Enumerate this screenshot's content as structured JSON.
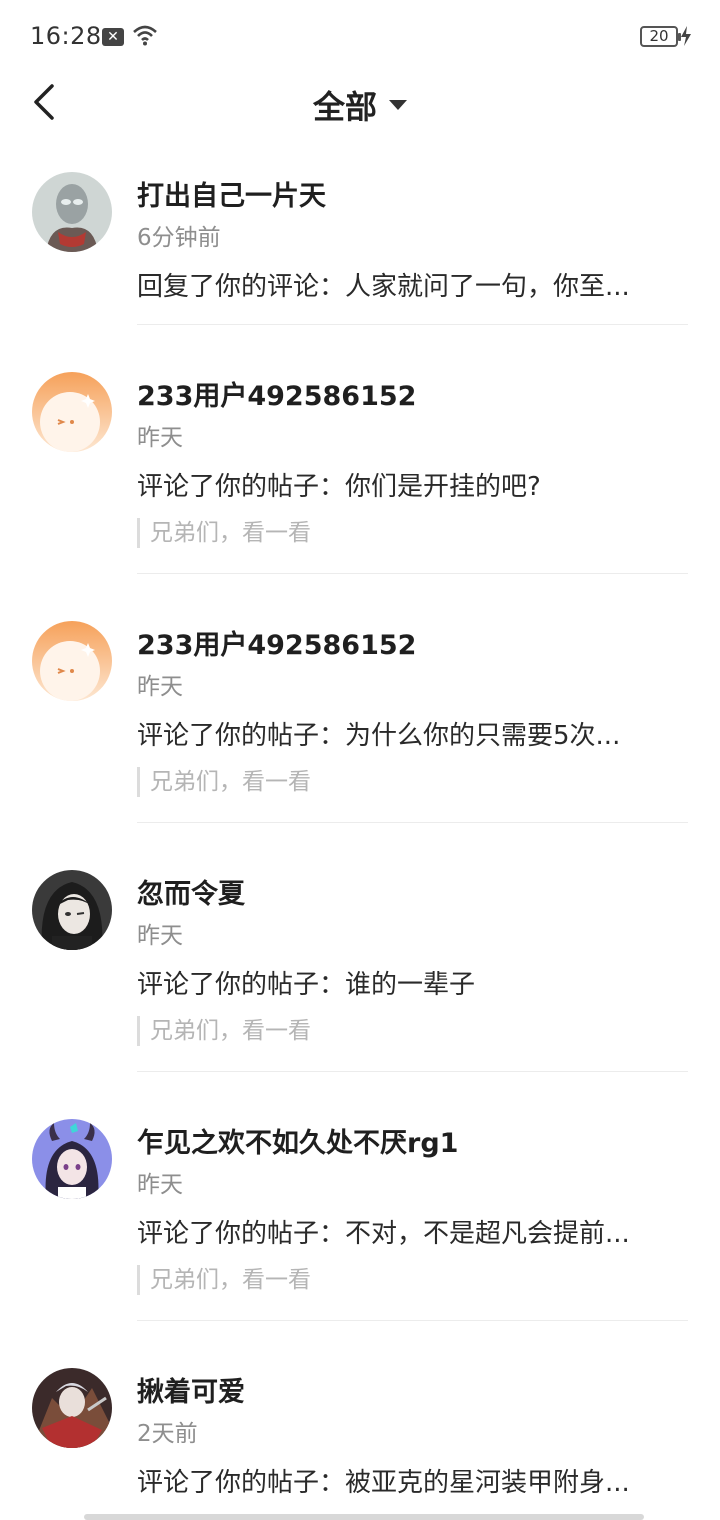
{
  "status_bar": {
    "time": "16:28",
    "battery": "20",
    "notification_icon": "x-box-icon",
    "wifi_icon": "wifi-icon"
  },
  "nav": {
    "title": "全部",
    "back_icon": "chevron-left-icon",
    "dropdown_icon": "caret-down-icon"
  },
  "items": [
    {
      "name": "打出自己一片天",
      "time": "6分钟前",
      "message": "回复了你的评论：人家就问了一句，你至...",
      "quote": "",
      "avatar": "avatar-armor-hero"
    },
    {
      "name": "233用户492586152",
      "time": "昨天",
      "message": "评论了你的帖子：你们是开挂的吧?",
      "quote": "兄弟们，看一看",
      "avatar": "avatar-orange-default"
    },
    {
      "name": "233用户492586152",
      "time": "昨天",
      "message": "评论了你的帖子：为什么你的只需要5次...",
      "quote": "兄弟们，看一看",
      "avatar": "avatar-orange-default"
    },
    {
      "name": "忽而令夏",
      "time": "昨天",
      "message": "评论了你的帖子：谁的一辈子",
      "quote": "兄弟们，看一看",
      "avatar": "avatar-dark-hair-girl"
    },
    {
      "name": "乍见之欢不如久处不厌rg1",
      "time": "昨天",
      "message": "评论了你的帖子：不对，不是超凡会提前...",
      "quote": "兄弟们，看一看",
      "avatar": "avatar-horned-girl"
    },
    {
      "name": "揪着可爱",
      "time": "2天前",
      "message": "评论了你的帖子：被亚克的星河装甲附身...",
      "quote": "",
      "avatar": "avatar-warrior"
    }
  ],
  "colors": {
    "name": "#1f1f1f",
    "time": "#8e8e8e",
    "quote": "#b5b5b5",
    "avatar_orange": "#f6a15a"
  }
}
